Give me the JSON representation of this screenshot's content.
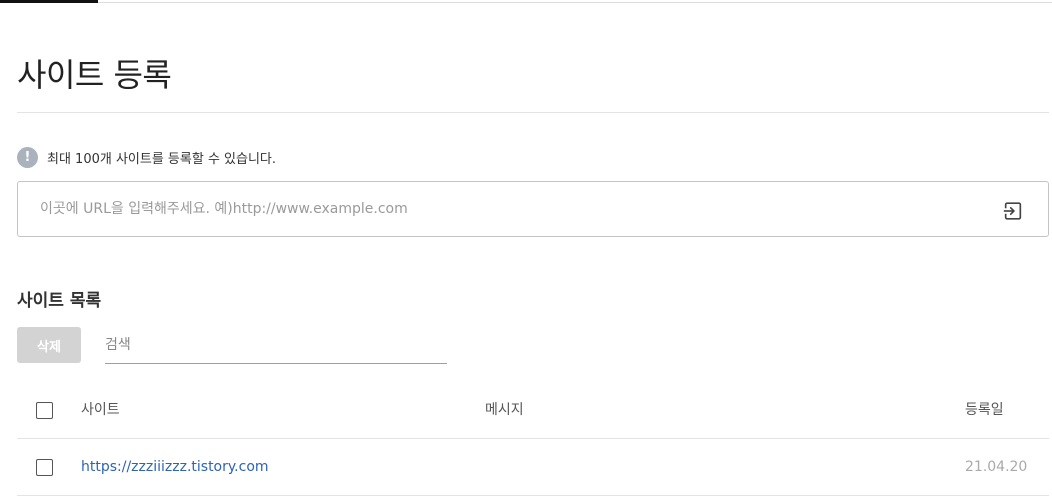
{
  "page": {
    "title": "사이트 등록"
  },
  "notice": {
    "icon": "exclamation-icon",
    "text": "최대 100개 사이트를 등록할 수 있습니다."
  },
  "url_input": {
    "value": "",
    "placeholder": "이곳에 URL을 입력해주세요. 예)http://www.example.com",
    "submit_icon": "enter-icon"
  },
  "site_list": {
    "title": "사이트 목록",
    "delete_label": "삭제",
    "search": {
      "value": "",
      "placeholder": "검색"
    },
    "columns": {
      "site": "사이트",
      "message": "메시지",
      "date": "등록일"
    },
    "rows": [
      {
        "site": "https://zzziiizzz.tistory.com",
        "message": "",
        "date": "21.04.20"
      }
    ]
  },
  "colors": {
    "link": "#2e63b8",
    "disabled_button": "#d3d3d3",
    "notice_icon": "#aab2bd"
  }
}
